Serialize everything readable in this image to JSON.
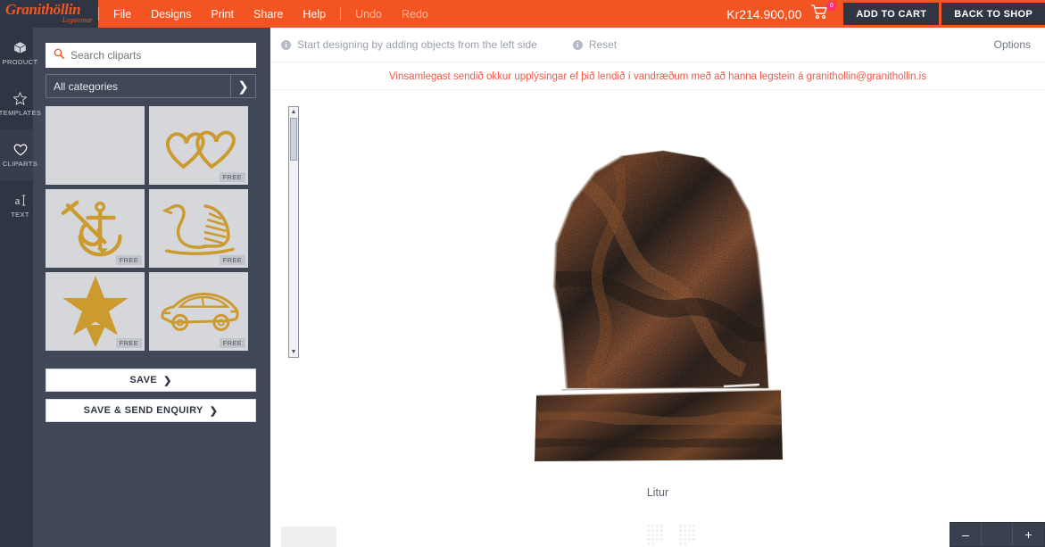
{
  "topbar": {
    "brand_name": "Granithöllin",
    "brand_sub": "Legsteinar",
    "menu": [
      {
        "label": "File",
        "name": "menu-file"
      },
      {
        "label": "Designs",
        "name": "menu-designs"
      },
      {
        "label": "Print",
        "name": "menu-print"
      },
      {
        "label": "Share",
        "name": "menu-share"
      },
      {
        "label": "Help",
        "name": "menu-help"
      }
    ],
    "undo_label": "Undo",
    "redo_label": "Redo",
    "price": "Kr214.900,00",
    "cart_badge": "0",
    "add_to_cart_label": "ADD TO CART",
    "back_to_shop_label": "BACK TO SHOP",
    "accent_color": "#f25521",
    "dark_color": "#2f3542"
  },
  "rail": {
    "items": [
      {
        "label": "PRODUCT",
        "icon": "cube-icon",
        "name": "rail-item-product",
        "selected": false
      },
      {
        "label": "TEMPLATES",
        "icon": "star-icon",
        "name": "rail-item-templates",
        "selected": false
      },
      {
        "label": "CLIPARTS",
        "icon": "heart-icon",
        "name": "rail-item-cliparts",
        "selected": true
      },
      {
        "label": "TEXT",
        "icon": "text-icon",
        "name": "rail-item-text",
        "selected": false
      }
    ]
  },
  "panel": {
    "search_placeholder": "Search cliparts",
    "search_value": "",
    "category_label": "All categories",
    "tiles": [
      {
        "icon": "blank-clipart",
        "free": "",
        "name": "clipart-tile-blank"
      },
      {
        "icon": "hearts-clipart",
        "free": "FREE",
        "name": "clipart-tile-hearts"
      },
      {
        "icon": "anchor-clipart",
        "free": "FREE",
        "name": "clipart-tile-anchor"
      },
      {
        "icon": "swan-clipart",
        "free": "FREE",
        "name": "clipart-tile-swan"
      },
      {
        "icon": "star-clipart",
        "free": "FREE",
        "name": "clipart-tile-star"
      },
      {
        "icon": "car-clipart",
        "free": "FREE",
        "name": "clipart-tile-car"
      }
    ],
    "clipart_color": "#cc9b30",
    "save_label": "SAVE",
    "save_enquiry_label": "SAVE & SEND ENQUIRY",
    "chevron": "❯"
  },
  "main": {
    "hint_text": "Start designing by adding objects from the left side",
    "reset_label": "Reset",
    "options_label": "Options",
    "notice": "Vinsamlegast sendið okkur upplýsingar ef þið lendið í vandræðum með að hanna legstein á granithollin@granithollin.is",
    "notice_color": "#f0594a",
    "color_section_label": "Litur",
    "zoom_out_label": "–",
    "zoom_in_label": "+"
  }
}
